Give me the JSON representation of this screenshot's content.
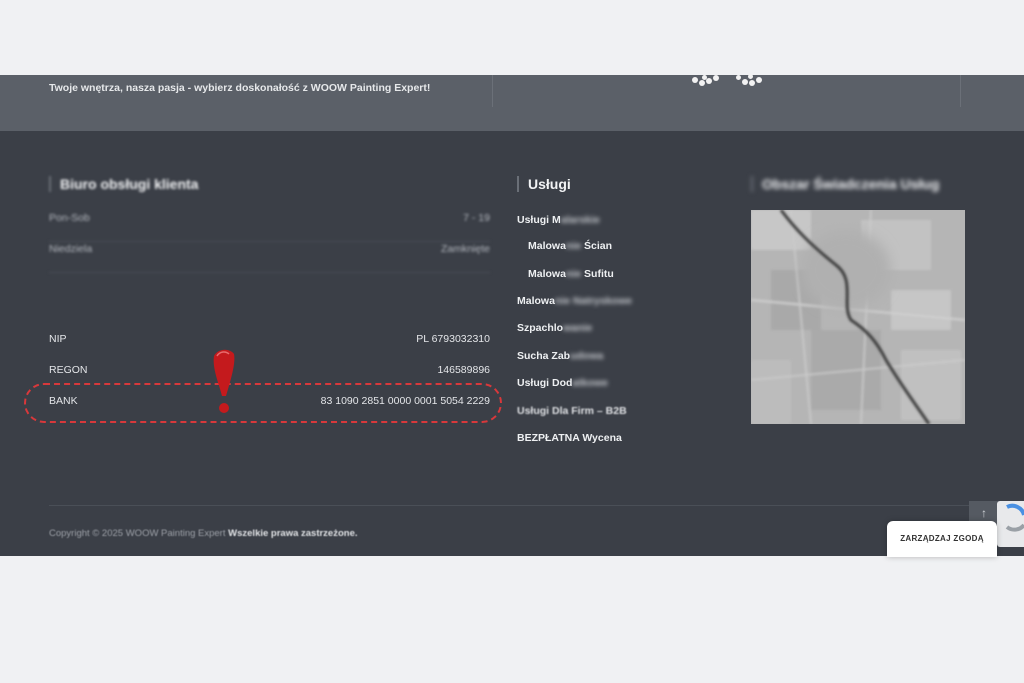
{
  "topband": {
    "tagline": "Twoje wnętrza, nasza pasja - wybierz doskonałość z WOOW Painting Expert!"
  },
  "office": {
    "title": "Biuro obsługi klienta",
    "hours": [
      {
        "day": "Pon-Sob",
        "time": "7 - 19"
      },
      {
        "day": "Niedziela",
        "time": "Zamknięte"
      }
    ],
    "info": [
      {
        "label": "NIP",
        "value": "PL 6793032310"
      },
      {
        "label": "REGON",
        "value": "146589896"
      },
      {
        "label": "BANK",
        "value": "83 1090 2851 0000 0001 5054 2229"
      }
    ]
  },
  "services": {
    "title": "Usługi",
    "items": [
      {
        "pre": "Usługi M",
        "blur": "alarskie",
        "post": ""
      },
      {
        "pre": "Malowa",
        "blur": "nie ",
        "post": "Ścian"
      },
      {
        "pre": "Malowa",
        "blur": "nie ",
        "post": "Sufitu"
      },
      {
        "pre": "Malowa",
        "blur": "nie Natryskowe",
        "post": ""
      },
      {
        "pre": "Szpachlo",
        "blur": "wanie",
        "post": ""
      },
      {
        "pre": "Sucha Zab",
        "blur": "udowa",
        "post": ""
      },
      {
        "pre": "Usługi Dod",
        "blur": "atkowe",
        "post": ""
      },
      {
        "pre": "Usługi Dla Firm – B2B",
        "blur": "",
        "post": ""
      },
      {
        "pre": "BEZPŁATNA Wycena",
        "blur": "",
        "post": ""
      }
    ]
  },
  "area": {
    "title": "Obszar Świadczenia Usług"
  },
  "footer": {
    "copyright": "Copyright © 2025 WOOW Painting Expert",
    "rights": "Wszelkie prawa zastrzeżone."
  },
  "consent": {
    "label": "ZARZĄDZAJ ZGODĄ"
  },
  "scrolltop": {
    "label": "↑"
  },
  "annotation": {
    "color": "#d8383b",
    "mark_color": "#c41a1d"
  }
}
